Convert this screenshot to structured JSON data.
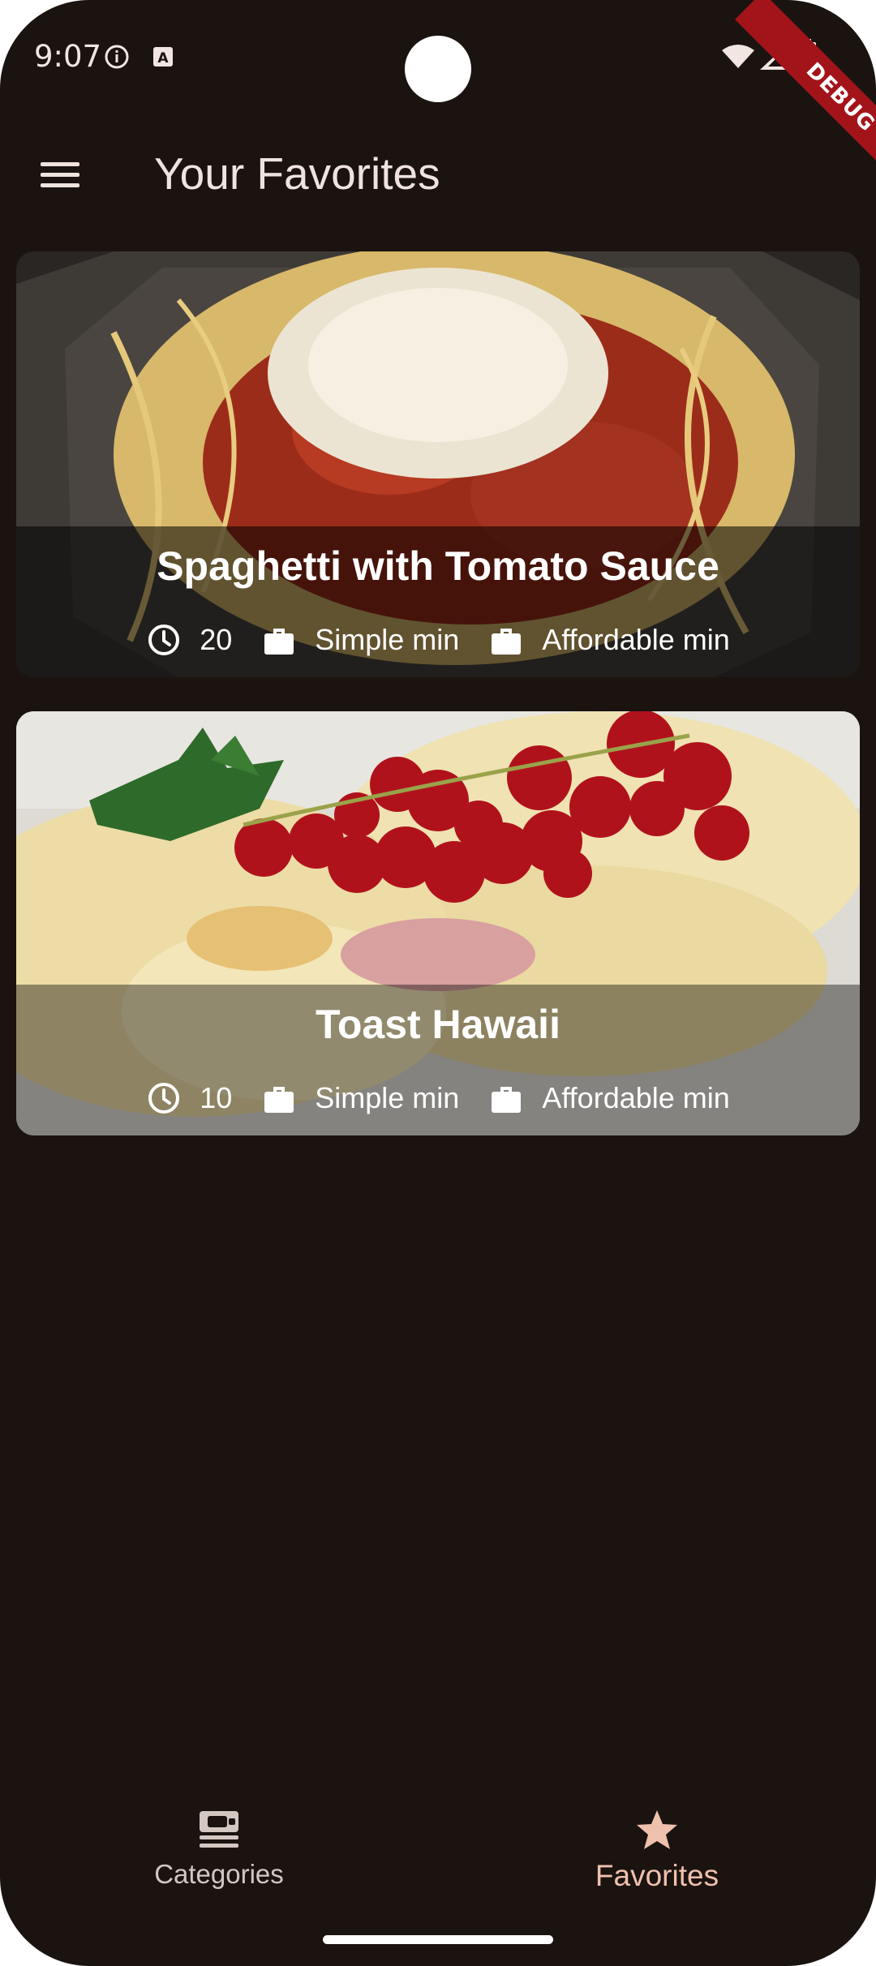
{
  "status_bar": {
    "time": "9:07",
    "debug_label": "DEBUG"
  },
  "app_bar": {
    "title": "Your Favorites"
  },
  "meals": [
    {
      "title": "Spaghetti with Tomato Sauce",
      "duration": "20",
      "complexity": "Simple min",
      "affordability": "Affordable min"
    },
    {
      "title": "Toast Hawaii",
      "duration": "10",
      "complexity": "Simple min",
      "affordability": "Affordable min"
    }
  ],
  "bottom_nav": {
    "items": [
      {
        "label": "Categories",
        "icon": "categories-icon",
        "selected": false
      },
      {
        "label": "Favorites",
        "icon": "star-icon",
        "selected": true
      }
    ]
  },
  "colors": {
    "background": "#1b1310",
    "selected_nav": "#f0c0ae",
    "unselected_nav": "#d3c7c2"
  }
}
